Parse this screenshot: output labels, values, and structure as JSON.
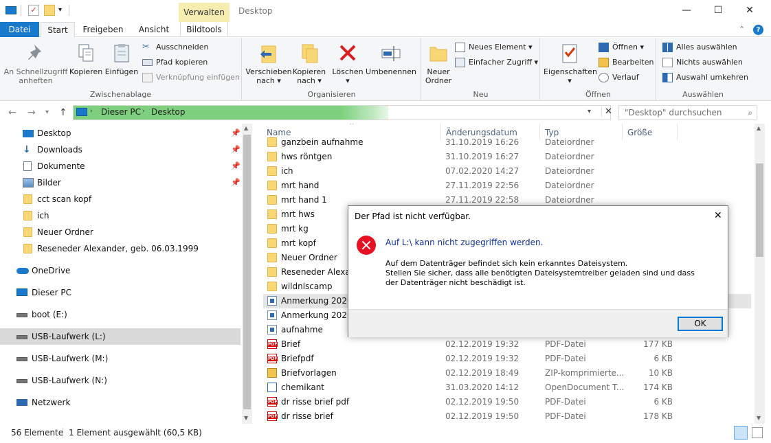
{
  "titlebar": {
    "context_tab": "Verwalten",
    "window_title": "Desktop",
    "minimize": "—",
    "maximize": "☐",
    "close": "✕"
  },
  "tabs": [
    "Datei",
    "Start",
    "Freigeben",
    "Ansicht",
    "Bildtools"
  ],
  "ribbon": {
    "clipboard": {
      "label": "Zwischenablage",
      "pin": "An Schnellzugriff anheften",
      "copy": "Kopieren",
      "paste": "Einfügen",
      "cut": "Ausschneiden",
      "copy_path": "Pfad kopieren",
      "paste_shortcut": "Verknüpfung einfügen"
    },
    "organize": {
      "label": "Organisieren",
      "move_to": "Verschieben nach",
      "copy_to": "Kopieren nach",
      "delete": "Löschen",
      "rename": "Umbenennen"
    },
    "new": {
      "label": "Neu",
      "new_folder": "Neuer Ordner",
      "new_item": "Neues Element",
      "easy_access": "Einfacher Zugriff"
    },
    "open": {
      "label": "Öffnen",
      "properties": "Eigenschaften",
      "open": "Öffnen",
      "edit": "Bearbeiten",
      "history": "Verlauf"
    },
    "select": {
      "label": "Auswählen",
      "select_all": "Alles auswählen",
      "select_none": "Nichts auswählen",
      "invert": "Auswahl umkehren"
    }
  },
  "address": {
    "crumbs": [
      "Dieser PC",
      "Desktop"
    ],
    "search_placeholder": "\"Desktop\" durchsuchen"
  },
  "nav": {
    "quick": [
      {
        "label": "Desktop",
        "icon": "desktop-icon",
        "pinned": true
      },
      {
        "label": "Downloads",
        "icon": "download-icon",
        "pinned": true
      },
      {
        "label": "Dokumente",
        "icon": "document-icon",
        "pinned": true
      },
      {
        "label": "Bilder",
        "icon": "pictures-icon",
        "pinned": true
      },
      {
        "label": "cct scan kopf",
        "icon": "folder-icon",
        "pinned": false
      },
      {
        "label": "ich",
        "icon": "folder-icon",
        "pinned": false
      },
      {
        "label": "Neuer Ordner",
        "icon": "folder-icon",
        "pinned": false
      },
      {
        "label": "Reseneder Alexander, geb. 06.03.1999",
        "icon": "folder-icon",
        "pinned": false
      }
    ],
    "onedrive": "OneDrive",
    "thispc": "Dieser PC",
    "drives": [
      "boot (E:)",
      "USB-Laufwerk (L:)",
      "USB-Laufwerk (M:)",
      "USB-Laufwerk (N:)"
    ],
    "network": "Netzwerk"
  },
  "columns": [
    "Name",
    "Änderungsdatum",
    "Typ",
    "Größe"
  ],
  "files": [
    {
      "name": "ganzbein aufnahme",
      "date": "31.10.2019 16:26",
      "type": "Dateiordner",
      "size": "",
      "kind": "folder"
    },
    {
      "name": "hws röntgen",
      "date": "31.10.2019 16:27",
      "type": "Dateiordner",
      "size": "",
      "kind": "folder"
    },
    {
      "name": "ich",
      "date": "07.02.2020 14:27",
      "type": "Dateiordner",
      "size": "",
      "kind": "folder"
    },
    {
      "name": "mrt hand",
      "date": "27.11.2019 22:56",
      "type": "Dateiordner",
      "size": "",
      "kind": "folder"
    },
    {
      "name": "mrt hand 1",
      "date": "27.11.2019 22:58",
      "type": "Dateiordner",
      "size": "",
      "kind": "folder"
    },
    {
      "name": "mrt hws",
      "date": "",
      "type": "",
      "size": "",
      "kind": "folder"
    },
    {
      "name": "mrt kg",
      "date": "",
      "type": "",
      "size": "",
      "kind": "folder"
    },
    {
      "name": "mrt kopf",
      "date": "",
      "type": "",
      "size": "",
      "kind": "folder"
    },
    {
      "name": "Neuer Ordner",
      "date": "",
      "type": "",
      "size": "",
      "kind": "folder"
    },
    {
      "name": "Reseneder Alexand",
      "date": "",
      "type": "",
      "size": "",
      "kind": "folder"
    },
    {
      "name": "wildniscamp",
      "date": "",
      "type": "",
      "size": "",
      "kind": "folder"
    },
    {
      "name": "Anmerkung 2020-0",
      "date": "",
      "type": "",
      "size": "",
      "kind": "img",
      "selected": true
    },
    {
      "name": "Anmerkung 2020-0",
      "date": "",
      "type": "",
      "size": "",
      "kind": "img"
    },
    {
      "name": "aufnahme",
      "date": "",
      "type": "",
      "size": "",
      "kind": "img"
    },
    {
      "name": "Brief",
      "date": "02.12.2019 19:32",
      "type": "PDF-Datei",
      "size": "177 KB",
      "kind": "pdf"
    },
    {
      "name": "Briefpdf",
      "date": "02.12.2019 19:32",
      "type": "PDF-Datei",
      "size": "6 KB",
      "kind": "pdf"
    },
    {
      "name": "Briefvorlagen",
      "date": "02.12.2019 18:49",
      "type": "ZIP-komprimierte...",
      "size": "10 KB",
      "kind": "zip"
    },
    {
      "name": "chemikant",
      "date": "31.03.2020 14:12",
      "type": "OpenDocument T...",
      "size": "174 KB",
      "kind": "odt"
    },
    {
      "name": "dr risse brief pdf",
      "date": "02.12.2019 19:50",
      "type": "PDF-Datei",
      "size": "6 KB",
      "kind": "pdf"
    },
    {
      "name": "dr risse brief",
      "date": "02.12.2019 19:50",
      "type": "PDF-Datei",
      "size": "178 KB",
      "kind": "pdf"
    }
  ],
  "status": {
    "count": "56 Elemente",
    "selection": "1 Element ausgewählt (60,5 KB)"
  },
  "dialog": {
    "title": "Der Pfad ist nicht verfügbar.",
    "main": "Auf L:\\ kann nicht zugegriffen werden.",
    "line1": "Auf dem Datenträger befindet sich kein erkanntes Dateisystem.",
    "line2": "Stellen Sie sicher, dass alle benötigten Dateisystemtreiber geladen sind und dass der Datenträger nicht beschädigt ist.",
    "ok": "OK"
  }
}
